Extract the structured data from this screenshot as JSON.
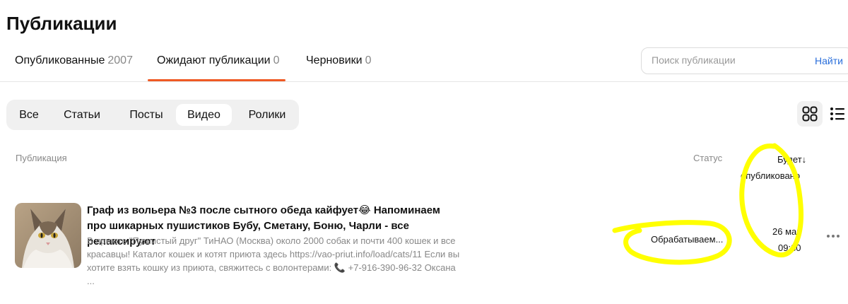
{
  "page": {
    "title": "Публикации"
  },
  "tabs": [
    {
      "label": "Опубликованные",
      "count": "2007"
    },
    {
      "label": "Ожидают публикации",
      "count": "0",
      "active": true
    },
    {
      "label": "Черновики",
      "count": "0"
    }
  ],
  "search": {
    "placeholder": "Поиск публикации",
    "value": "",
    "button": "Найти"
  },
  "filters": [
    {
      "label": "Все"
    },
    {
      "label": "Статьи"
    },
    {
      "label": "Посты"
    },
    {
      "label": "Видео",
      "active": true
    },
    {
      "label": "Ролики"
    }
  ],
  "view_toggle": {
    "grid_icon": "grid-icon",
    "list_icon": "list-icon",
    "active": "grid"
  },
  "columns": {
    "publication": "Публикация",
    "status": "Статус",
    "scheduled_line1": "Будет↓",
    "scheduled_line2": "опубликовано"
  },
  "row": {
    "thumbnail_icon": "cat-photo",
    "title": "Граф из вольера №3 после сытного обеда кайфует😂 Напоминаем про шикарных пушистиков Бубу, Сметану, Боню, Чарли - все релаксируют",
    "description": "В приюте \"Пушистый друг\" ТиНАО (Москва) около 2000 собак и почти 400 кошек и все красавцы! Каталог кошек и котят приюта здесь https://vao-priut.info/load/cats/11  Если вы хотите взять кошку из приюта, свяжитесь с волонтерами:  📞 +7-916-390-96-32 Оксана ...",
    "status": "Обрабатываем...",
    "date": "26 мар",
    "time": "09:30",
    "more_icon": "more-horizontal-icon"
  },
  "colors": {
    "accent": "#ef5a24",
    "link": "#2a6fdb",
    "highlight": "#ffff00",
    "muted": "#888888"
  }
}
